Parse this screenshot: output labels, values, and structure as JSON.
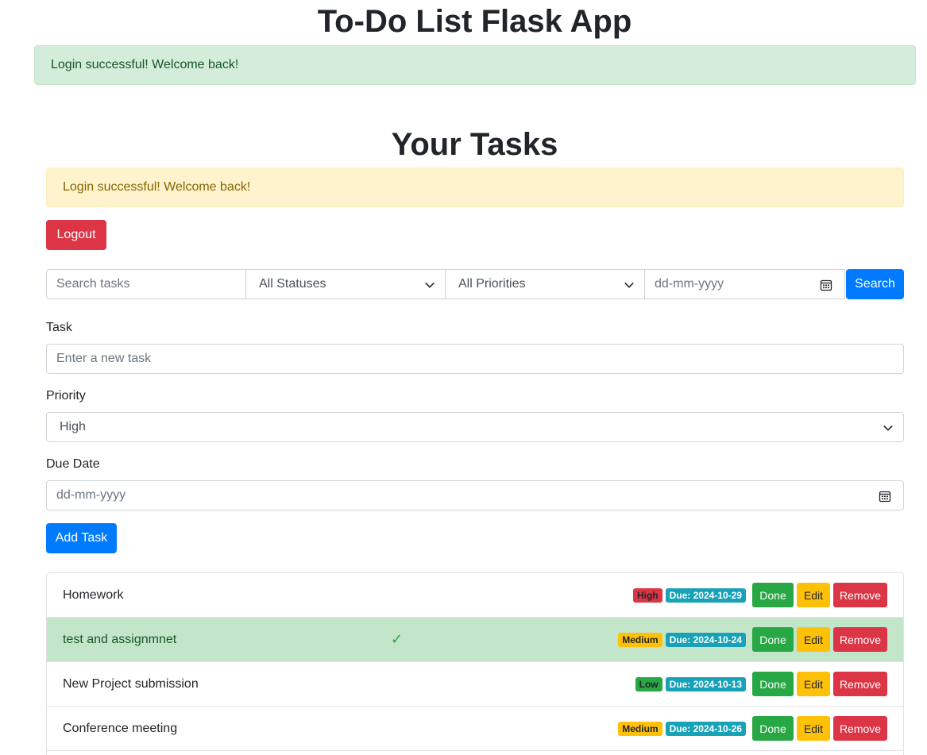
{
  "app": {
    "title": "To-Do List Flask App"
  },
  "alerts": {
    "top_success": "Login successful! Welcome back!",
    "warning": "Login successful! Welcome back!"
  },
  "section": {
    "title": "Your Tasks"
  },
  "buttons": {
    "logout": "Logout",
    "search": "Search",
    "add_task": "Add Task"
  },
  "search": {
    "placeholder": "Search tasks",
    "status_selected": "All Statuses",
    "priority_selected": "All Priorities",
    "date_placeholder": "dd-mm-yyyy"
  },
  "form": {
    "task_label": "Task",
    "task_placeholder": "Enter a new task",
    "priority_label": "Priority",
    "priority_selected": "High",
    "due_label": "Due Date",
    "due_placeholder": "dd-mm-yyyy"
  },
  "tasks": [
    {
      "name": "Homework",
      "priority": "High",
      "due": "Due: 2024-10-29",
      "done": false
    },
    {
      "name": "test and assignmnet",
      "priority": "Medium",
      "due": "Due: 2024-10-24",
      "done": true,
      "check": "✓"
    },
    {
      "name": "New Project submission",
      "priority": "Low",
      "due": "Due: 2024-10-13",
      "done": false
    },
    {
      "name": "Conference meeting",
      "priority": "Medium",
      "due": "Due: 2024-10-26",
      "done": false
    }
  ],
  "task_buttons": {
    "done": "Done",
    "edit": "Edit",
    "remove": "Remove"
  },
  "colors": {
    "primary": "#007bff",
    "danger": "#dc3545",
    "warning": "#ffc107",
    "success": "#28a745",
    "info": "#17a2b8"
  }
}
